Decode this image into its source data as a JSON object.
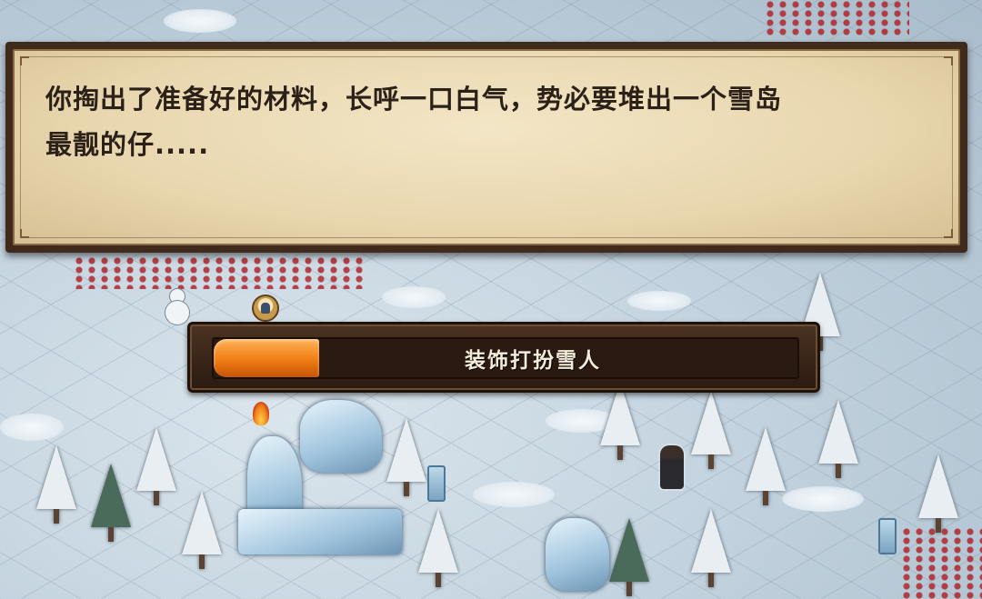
{
  "dialog": {
    "line1": "你掏出了准备好的材料，长呼一口白气，势必要堆出一个雪岛",
    "line2": "最靓的仔....."
  },
  "progress": {
    "label": "装饰打扮雪人",
    "fraction": 0.18
  },
  "colors": {
    "parchment": "#eddcb5",
    "frame": "#3f2a1c",
    "progress_fill": "#f07d12",
    "snow": "#c3d3df"
  },
  "icons": {
    "action_icon": "character-portrait-icon"
  }
}
